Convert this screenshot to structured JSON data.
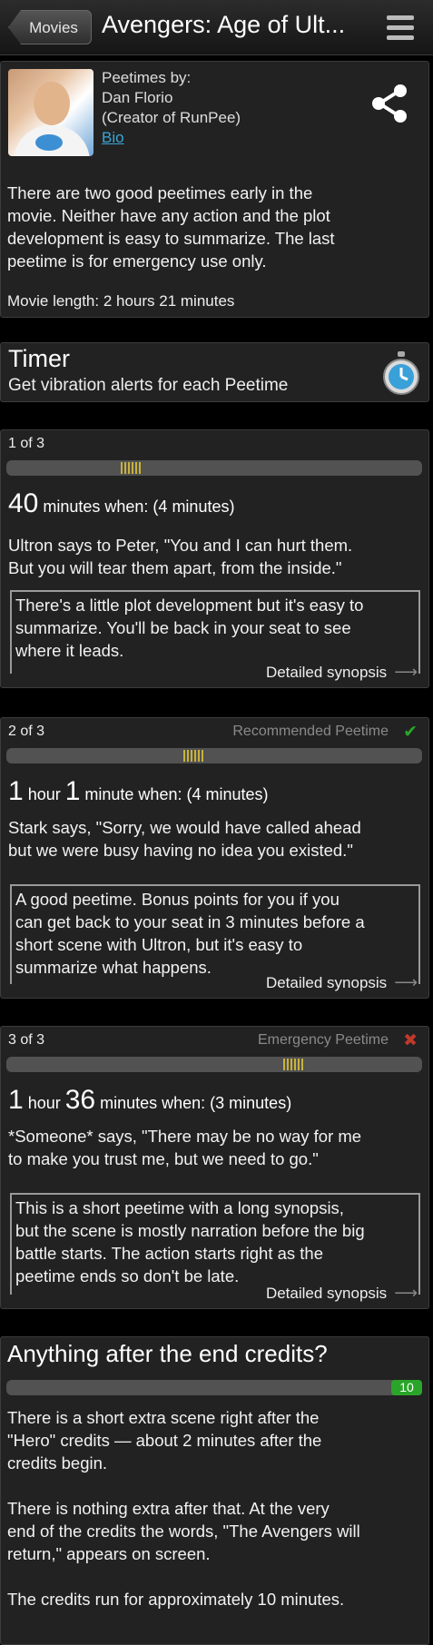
{
  "nav": {
    "back_label": "Movies",
    "title": "Avengers: Age of Ult...",
    "menu_icon": "hamburger-menu-icon"
  },
  "author": {
    "peetimes_by": "Peetimes by:",
    "name": "Dan Florio",
    "role": "(Creator of RunPee)",
    "bio_link": "Bio",
    "share_icon": "share-icon"
  },
  "intro": {
    "lines": [
      "There are two good peetimes early in the",
      "movie. Neither have any action and the plot",
      "development is easy to summarize. The last",
      "peetime is for emergency use only."
    ],
    "movie_length": "Movie length: 2 hours  21 minutes"
  },
  "timer": {
    "title": "Timer",
    "subtitle": "Get vibration alerts for each Peetime",
    "icon": "stopwatch-icon"
  },
  "peetimes": [
    {
      "index": "1 of 3",
      "tag": "",
      "position_pct": 30,
      "time_parts": [
        {
          "num": "40",
          "unit": " minutes when: (4 minutes)"
        }
      ],
      "cue": [
        "Ultron says to Peter, \"You and I can hurt them.",
        "But you will tear them apart, from the inside.\""
      ],
      "note": [
        "There's a little plot development but it's easy to",
        "summarize. You'll be back in your seat to see",
        "where it leads."
      ],
      "synopsis_label": "Detailed synopsis"
    },
    {
      "index": "2 of 3",
      "tag": "Recommended Peetime",
      "tag_icon": "checkmark-icon",
      "position_pct": 45,
      "time_parts": [
        {
          "num": "1",
          "unit": " hour "
        },
        {
          "num": "1",
          "unit": " minute when: (4 minutes)"
        }
      ],
      "cue": [
        "Stark says, \"Sorry, we would have called ahead",
        "but we were busy having no idea you existed.\""
      ],
      "note": [
        "A good peetime. Bonus points for you if you",
        "can get back to your seat in 3 minutes before a",
        "short scene with Ultron, but it's easy to",
        "summarize what happens."
      ],
      "synopsis_label": "Detailed synopsis"
    },
    {
      "index": "3 of 3",
      "tag": "Emergency Peetime",
      "tag_icon": "x-icon",
      "position_pct": 69,
      "time_parts": [
        {
          "num": "1",
          "unit": " hour "
        },
        {
          "num": "36",
          "unit": " minutes when: (3 minutes)"
        }
      ],
      "cue": [
        "*Someone* says, \"There may be no way for me",
        "to make you trust me, but we need to go.\""
      ],
      "note": [
        "This is a short peetime with a long synopsis,",
        "but the scene is mostly narration before the big",
        "battle starts. The action starts right as the",
        "peetime ends so don't be late."
      ],
      "synopsis_label": "Detailed synopsis"
    }
  ],
  "credits": {
    "title": "Anything after the end credits?",
    "badge": "10",
    "paragraphs": [
      [
        "There is a short extra scene right after the",
        "\"Hero\" credits — about 2 minutes after the",
        "credits begin."
      ],
      [
        "There is nothing extra after that. At the very",
        "end of the credits the words, \"The Avengers will",
        "return,\" appears on screen."
      ],
      [
        "The credits run for approximately 10 minutes."
      ]
    ]
  },
  "colors": {
    "accent_link": "#3aa6d8",
    "marker": "#c9b23a",
    "recommended": "#2aa52a",
    "emergency": "#c0392b",
    "badge": "#2aa52a"
  }
}
